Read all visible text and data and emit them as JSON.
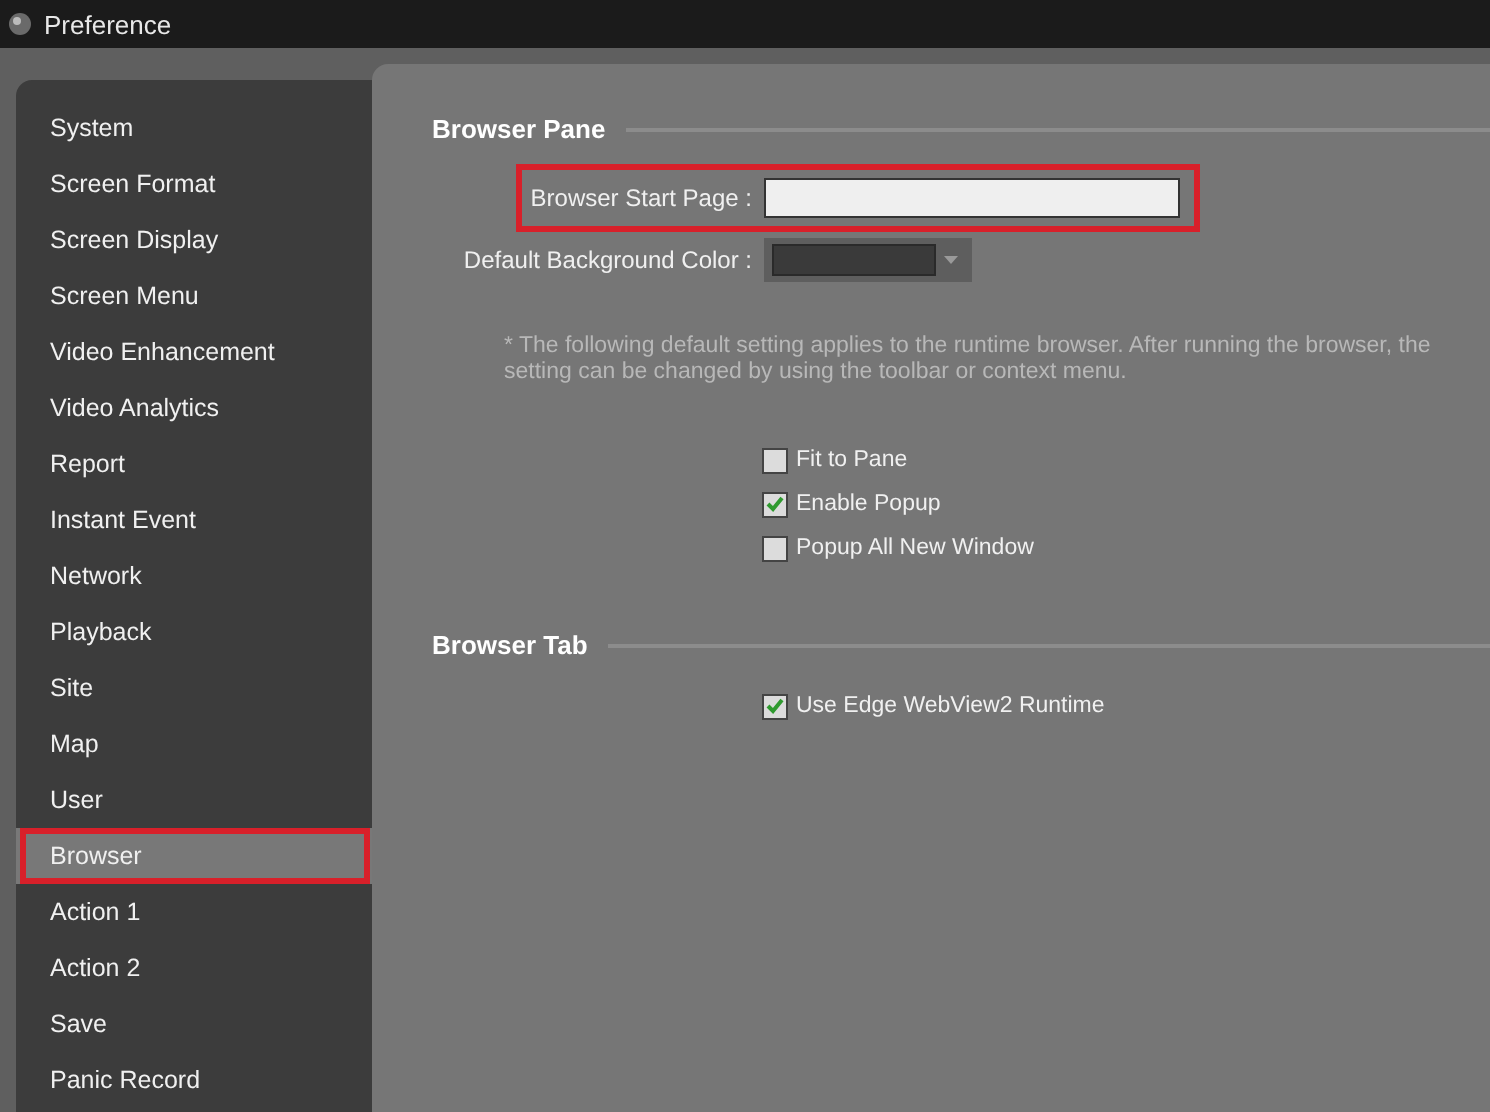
{
  "window": {
    "title": "Preference"
  },
  "sidebar": {
    "items": [
      {
        "label": "System",
        "selected": false,
        "highlighted": false
      },
      {
        "label": "Screen Format",
        "selected": false,
        "highlighted": false
      },
      {
        "label": "Screen Display",
        "selected": false,
        "highlighted": false
      },
      {
        "label": "Screen Menu",
        "selected": false,
        "highlighted": false
      },
      {
        "label": "Video Enhancement",
        "selected": false,
        "highlighted": false
      },
      {
        "label": "Video Analytics",
        "selected": false,
        "highlighted": false
      },
      {
        "label": "Report",
        "selected": false,
        "highlighted": false
      },
      {
        "label": "Instant Event",
        "selected": false,
        "highlighted": false
      },
      {
        "label": "Network",
        "selected": false,
        "highlighted": false
      },
      {
        "label": "Playback",
        "selected": false,
        "highlighted": false
      },
      {
        "label": "Site",
        "selected": false,
        "highlighted": false
      },
      {
        "label": "Map",
        "selected": false,
        "highlighted": false
      },
      {
        "label": "User",
        "selected": false,
        "highlighted": false
      },
      {
        "label": "Browser",
        "selected": true,
        "highlighted": true
      },
      {
        "label": "Action 1",
        "selected": false,
        "highlighted": false
      },
      {
        "label": "Action 2",
        "selected": false,
        "highlighted": false
      },
      {
        "label": "Save",
        "selected": false,
        "highlighted": false
      },
      {
        "label": "Panic Record",
        "selected": false,
        "highlighted": false
      }
    ]
  },
  "sections": [
    {
      "title": "Browser Pane",
      "fields": [
        {
          "kind": "text",
          "label": "Browser Start Page :",
          "highlighted": true
        },
        {
          "kind": "color",
          "label": "Default Background Color :",
          "color": "#3a3a3a"
        }
      ],
      "note": "* The following default setting applies to the runtime browser. After running the browser, the setting can be changed by using the toolbar or context menu.",
      "checkboxes": [
        {
          "label": "Fit to Pane",
          "checked": false
        },
        {
          "label": "Enable Popup",
          "checked": true
        },
        {
          "label": "Popup All New Window",
          "checked": false
        }
      ]
    },
    {
      "title": "Browser Tab",
      "checkboxes": [
        {
          "label": "Use Edge WebView2 Runtime",
          "checked": true
        }
      ]
    }
  ]
}
